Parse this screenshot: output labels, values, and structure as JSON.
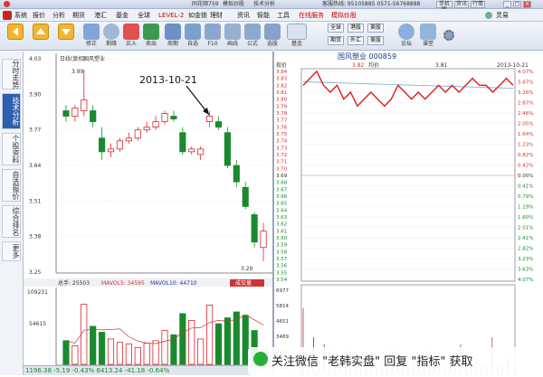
{
  "window": {
    "app_title": "同花顺759",
    "mode": "模拟炒股",
    "tech_analysis": "技术分析",
    "hotline": "客服热线: 95105885 0571-56768888",
    "right_buttons": [
      "手机版",
      "资讯",
      "行情"
    ]
  },
  "menu": {
    "items": [
      "系统",
      "报价",
      "分析",
      "期货",
      "港汇",
      "基金",
      "全球",
      "LEVEL-2",
      "如金锁",
      "理财",
      "资讯",
      "智能",
      "工具",
      "在线服务",
      "模拟炒股"
    ],
    "user": "灵易"
  },
  "toolbar": {
    "tools": [
      {
        "label": "",
        "icon": "back-arrow-icon"
      },
      {
        "label": "",
        "icon": "up-arrow-icon"
      },
      {
        "label": "",
        "icon": "down-arrow-icon"
      },
      {
        "label": "修正",
        "icon": "edit-icon"
      },
      {
        "label": "剩缘",
        "icon": "clock-icon"
      },
      {
        "label": "买入",
        "icon": "buy-icon"
      },
      {
        "label": "卖出",
        "icon": "sell-icon"
      },
      {
        "label": "周期",
        "icon": "period-icon"
      },
      {
        "label": "自选",
        "icon": "star-icon"
      },
      {
        "label": "F10",
        "icon": "f10-icon"
      },
      {
        "label": "画线",
        "icon": "draw-line-icon"
      },
      {
        "label": "公式",
        "icon": "formula-icon"
      },
      {
        "label": "选股",
        "icon": "stock-filter-icon"
      },
      {
        "label": "基金",
        "icon": "fund-icon"
      },
      {
        "label": "论坛",
        "icon": "forum-icon"
      },
      {
        "label": "课堂",
        "icon": "class-icon"
      }
    ],
    "grid_buttons": [
      "全球",
      "港股",
      "美股",
      "期货",
      "外汇",
      "美股"
    ],
    "settings_icon": "gear-icon"
  },
  "sidebar": {
    "tabs": [
      "分时走势",
      "技术分析",
      "个股资料",
      "自选报价",
      "综合排名",
      "更多"
    ],
    "active": 1
  },
  "kline": {
    "header_left": "日线(复权)",
    "header_stock": "国风塑业",
    "y_ticks": [
      "4.03",
      "3.90",
      "3.77",
      "3.64",
      "3.51",
      "3.38",
      "3.25"
    ],
    "annotation_date": "2013-10-21",
    "high_label": "3.99",
    "low_label": "3.29",
    "candle_up_color": "#d9262c",
    "candle_down_color": "#1a8a2e"
  },
  "volume": {
    "header_left": "总手: 25503",
    "ma5": "MAVOL5: 34595",
    "ma10": "MAVOL10: 44710",
    "tab_label": "成交量",
    "y_ticks": [
      "109231",
      "54615"
    ],
    "x_labels": [
      "09",
      "10"
    ]
  },
  "intraday": {
    "title": "国风塑业  000859",
    "label_left": "现价",
    "price_now": "3.82",
    "avg_label": "均价",
    "avg_value": "3.81",
    "date": "2013-10-21",
    "left_ticks": [
      "3.84",
      "3.83",
      "3.82",
      "3.81",
      "3.80",
      "3.79",
      "3.78",
      "3.77",
      "3.76",
      "3.75",
      "3.74",
      "3.73",
      "3.72",
      "3.71",
      "3.70",
      "3.69",
      "3.68",
      "3.67",
      "3.66",
      "3.65",
      "3.64",
      "3.63",
      "3.62",
      "3.61",
      "3.60",
      "3.59",
      "3.58",
      "3.57",
      "3.56",
      "3.55",
      "3.54"
    ],
    "right_ticks": [
      "4.07%",
      "3.67%",
      "3.26%",
      "2.87%",
      "2.46%",
      "2.05%",
      "1.64%",
      "1.23%",
      "0.82%",
      "0.42%",
      "0.00%",
      "0.41%",
      "0.79%",
      "1.19%",
      "1.60%",
      "2.01%",
      "2.41%",
      "2.82%",
      "3.23%",
      "3.63%",
      "4.07%"
    ],
    "volume_ticks": [
      "6977",
      "5814",
      "4651",
      "3489",
      "2326",
      "1201"
    ]
  },
  "status": {
    "text": "1196.38 -5.19 -0.43%  6413.24 -41.18 -0.64%"
  },
  "watermark": {
    "text": "关注微信 \"老韩实盘\" 回复 \"指标\" 获取"
  },
  "chart_data": {
    "type": "candlestick",
    "title": "国风塑业 日线(复权)",
    "ylim": [
      3.25,
      4.03
    ],
    "annotation": "2013-10-21",
    "candles": [
      {
        "o": 3.84,
        "h": 3.86,
        "l": 3.8,
        "c": 3.82
      },
      {
        "o": 3.82,
        "h": 3.86,
        "l": 3.8,
        "c": 3.85
      },
      {
        "o": 3.84,
        "h": 3.99,
        "l": 3.82,
        "c": 3.88
      },
      {
        "o": 3.84,
        "h": 3.86,
        "l": 3.78,
        "c": 3.8
      },
      {
        "o": 3.74,
        "h": 3.78,
        "l": 3.66,
        "c": 3.69
      },
      {
        "o": 3.69,
        "h": 3.72,
        "l": 3.67,
        "c": 3.7
      },
      {
        "o": 3.7,
        "h": 3.74,
        "l": 3.69,
        "c": 3.73
      },
      {
        "o": 3.73,
        "h": 3.76,
        "l": 3.72,
        "c": 3.74
      },
      {
        "o": 3.74,
        "h": 3.78,
        "l": 3.73,
        "c": 3.77
      },
      {
        "o": 3.77,
        "h": 3.8,
        "l": 3.76,
        "c": 3.78
      },
      {
        "o": 3.78,
        "h": 3.82,
        "l": 3.77,
        "c": 3.8
      },
      {
        "o": 3.8,
        "h": 3.84,
        "l": 3.79,
        "c": 3.83
      },
      {
        "o": 3.82,
        "h": 3.84,
        "l": 3.8,
        "c": 3.81
      },
      {
        "o": 3.76,
        "h": 3.78,
        "l": 3.68,
        "c": 3.69
      },
      {
        "o": 3.69,
        "h": 3.71,
        "l": 3.68,
        "c": 3.7
      },
      {
        "o": 3.68,
        "h": 3.71,
        "l": 3.66,
        "c": 3.7
      },
      {
        "o": 3.8,
        "h": 3.84,
        "l": 3.78,
        "c": 3.82
      },
      {
        "o": 3.8,
        "h": 3.82,
        "l": 3.77,
        "c": 3.78
      },
      {
        "o": 3.76,
        "h": 3.78,
        "l": 3.63,
        "c": 3.64
      },
      {
        "o": 3.64,
        "h": 3.66,
        "l": 3.56,
        "c": 3.58
      },
      {
        "o": 3.56,
        "h": 3.58,
        "l": 3.48,
        "c": 3.49
      },
      {
        "o": 3.46,
        "h": 3.47,
        "l": 3.34,
        "c": 3.36
      },
      {
        "o": 3.34,
        "h": 3.43,
        "l": 3.29,
        "c": 3.4
      }
    ],
    "volume": [
      28,
      22,
      71,
      45,
      38,
      30,
      26,
      24,
      20,
      25,
      28,
      40,
      35,
      60,
      52,
      30,
      70,
      48,
      55,
      62,
      58,
      40,
      18
    ]
  }
}
